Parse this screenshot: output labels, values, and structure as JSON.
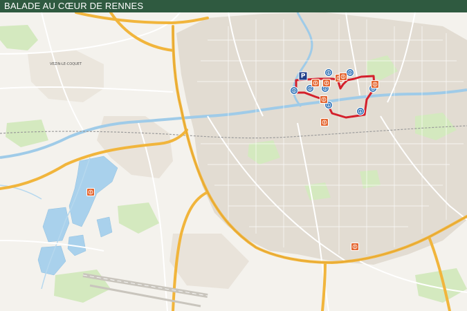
{
  "header": {
    "title": "BALADE AU CŒUR DE RENNES"
  },
  "map": {
    "place_labels": [
      "VEZIN-LE-COQUET"
    ],
    "colors": {
      "title_bar": "#2f5a40",
      "route": "#d4202c",
      "info_marker": "#2b6fb5",
      "poi_marker": "#e4652f",
      "start_marker": "#1f3e8a",
      "motorway": "#f1b53c",
      "river": "#9fcbe8",
      "urban": "#ddd6cc",
      "parks": "#cfe6b8"
    },
    "icons": {
      "start": "parking-flag-icon",
      "info": "info-pin-icon",
      "poi": "point-of-interest-pin-icon"
    },
    "markers": [
      {
        "kind": "start",
        "glyph": "P"
      },
      {
        "kind": "info",
        "glyph": "i"
      },
      {
        "kind": "info",
        "glyph": "i"
      },
      {
        "kind": "info",
        "glyph": "i"
      },
      {
        "kind": "info",
        "glyph": "i"
      },
      {
        "kind": "info",
        "glyph": "i"
      },
      {
        "kind": "info",
        "glyph": "i"
      },
      {
        "kind": "info",
        "glyph": "i"
      },
      {
        "kind": "info",
        "glyph": "i"
      },
      {
        "kind": "poi",
        "glyph": "!"
      },
      {
        "kind": "poi",
        "glyph": "!"
      },
      {
        "kind": "poi",
        "glyph": "!"
      },
      {
        "kind": "poi",
        "glyph": "!"
      },
      {
        "kind": "poi",
        "glyph": "!"
      },
      {
        "kind": "poi",
        "glyph": "!"
      },
      {
        "kind": "poi",
        "glyph": "!"
      },
      {
        "kind": "poi",
        "glyph": "!"
      },
      {
        "kind": "poi",
        "glyph": "!"
      }
    ]
  }
}
